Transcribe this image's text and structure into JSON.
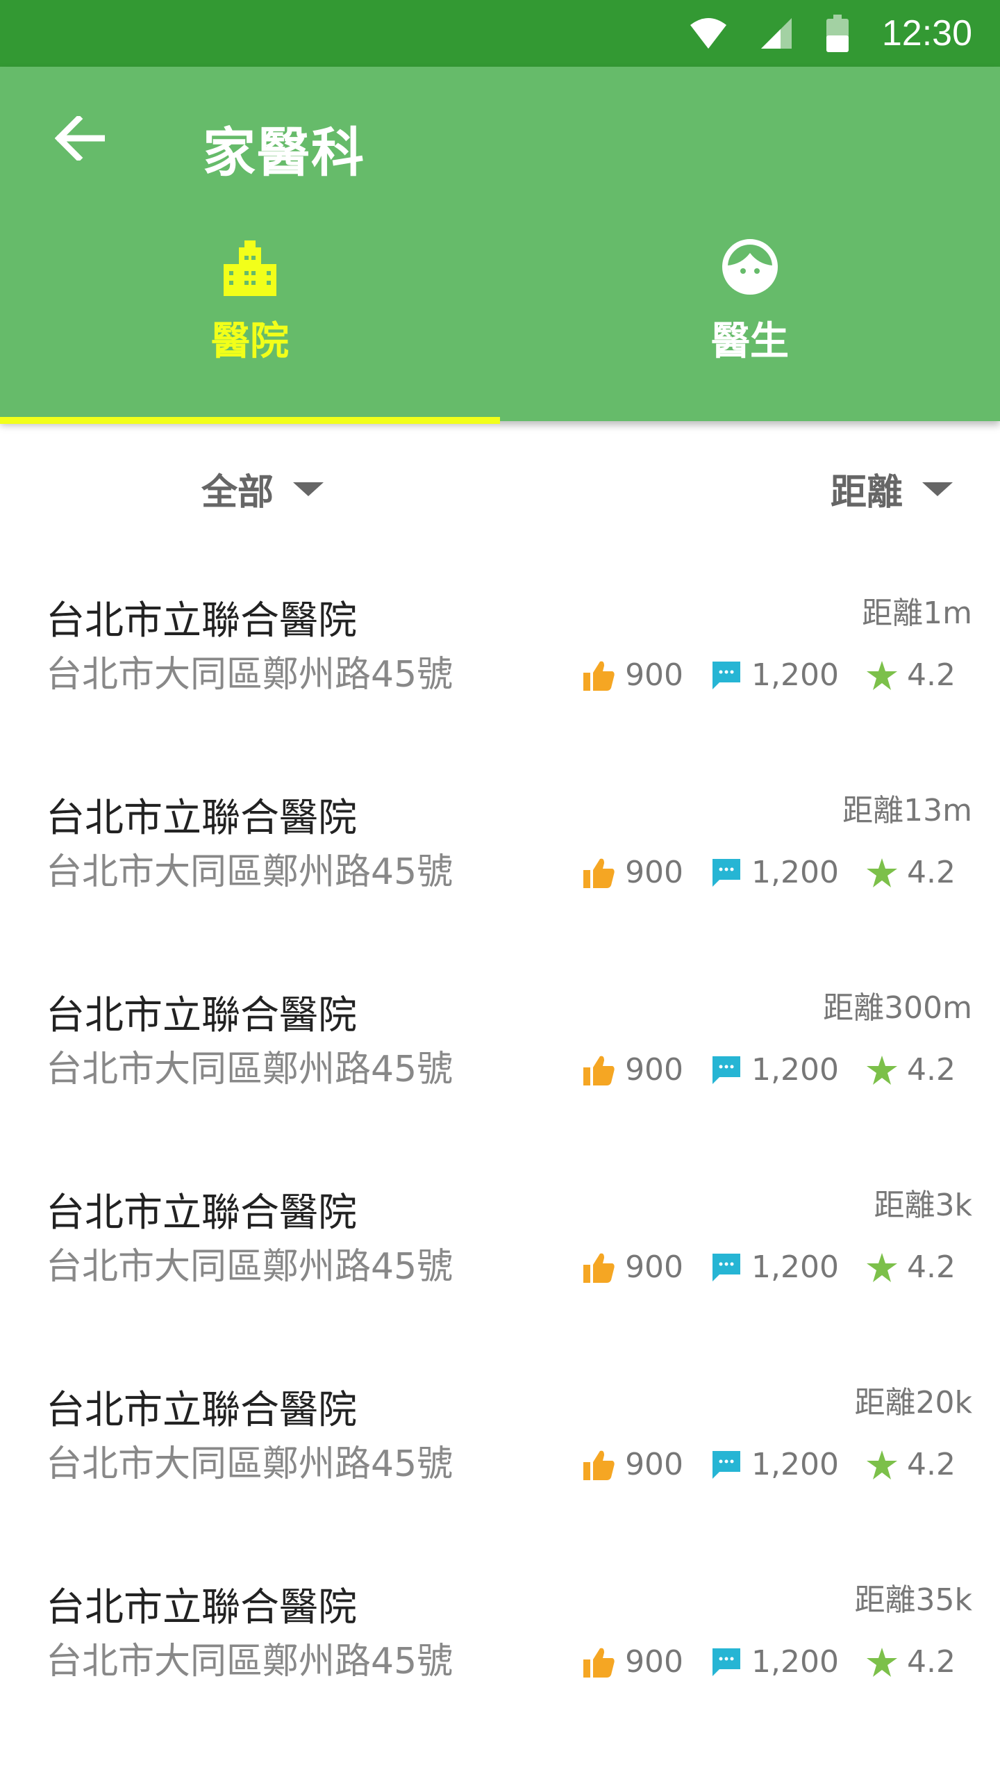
{
  "status_bar": {
    "time": "12:30"
  },
  "app_bar": {
    "title": "家醫科"
  },
  "tabs": [
    {
      "label": "醫院",
      "icon": "building-icon",
      "active": true
    },
    {
      "label": "醫生",
      "icon": "face-icon",
      "active": false
    }
  ],
  "filters": {
    "category": "全部",
    "sort": "距離"
  },
  "colors": {
    "status_bar": "#339933",
    "app_bar": "#66bb6a",
    "active_tab": "#f2ff1a",
    "thumb": "#f5a623",
    "comment": "#26b5d4",
    "star": "#7cc04a"
  },
  "hospitals": [
    {
      "name": "台北市立聯合醫院",
      "address": "台北市大同區鄭州路45號",
      "distance": "距離1m",
      "likes": "900",
      "comments": "1,200",
      "rating": "4.2"
    },
    {
      "name": "台北市立聯合醫院",
      "address": "台北市大同區鄭州路45號",
      "distance": "距離13m",
      "likes": "900",
      "comments": "1,200",
      "rating": "4.2"
    },
    {
      "name": "台北市立聯合醫院",
      "address": "台北市大同區鄭州路45號",
      "distance": "距離300m",
      "likes": "900",
      "comments": "1,200",
      "rating": "4.2"
    },
    {
      "name": "台北市立聯合醫院",
      "address": "台北市大同區鄭州路45號",
      "distance": "距離3k",
      "likes": "900",
      "comments": "1,200",
      "rating": "4.2"
    },
    {
      "name": "台北市立聯合醫院",
      "address": "台北市大同區鄭州路45號",
      "distance": "距離20k",
      "likes": "900",
      "comments": "1,200",
      "rating": "4.2"
    },
    {
      "name": "台北市立聯合醫院",
      "address": "台北市大同區鄭州路45號",
      "distance": "距離35k",
      "likes": "900",
      "comments": "1,200",
      "rating": "4.2"
    }
  ]
}
